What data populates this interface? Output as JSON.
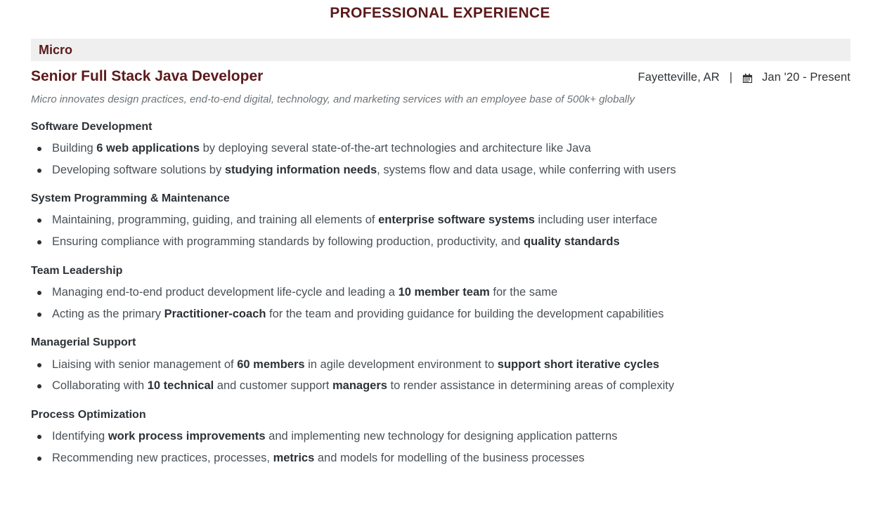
{
  "colors": {
    "accent": "#5c1a1b",
    "band_bg": "#efefef",
    "body_text": "#4a5057",
    "strong_text": "#2d3238",
    "muted_italic": "#6f7479"
  },
  "header": {
    "section_title": "PROFESSIONAL EXPERIENCE"
  },
  "experience": {
    "company": "Micro",
    "job_title": "Senior Full Stack Java Developer",
    "location": "Fayetteville, AR",
    "separator": "|",
    "calendar_icon": "calendar-icon",
    "dates": "Jan '20  -  Present",
    "company_description": "Micro innovates design practices, end-to-end digital, technology, and marketing services with an employee base of 500k+ globally",
    "groups": [
      {
        "heading": "Software Development",
        "bullets": [
          [
            {
              "t": "Building ",
              "b": false
            },
            {
              "t": "6 web applications",
              "b": true
            },
            {
              "t": " by deploying several state-of-the-art technologies and architecture like Java",
              "b": false
            }
          ],
          [
            {
              "t": "Developing software solutions by ",
              "b": false
            },
            {
              "t": "studying information needs",
              "b": true
            },
            {
              "t": ", systems flow and data usage, while conferring with users",
              "b": false
            }
          ]
        ]
      },
      {
        "heading": "System Programming & Maintenance",
        "bullets": [
          [
            {
              "t": "Maintaining, programming, guiding, and training all elements of ",
              "b": false
            },
            {
              "t": "enterprise software systems",
              "b": true
            },
            {
              "t": " including user interface",
              "b": false
            }
          ],
          [
            {
              "t": "Ensuring compliance with programming standards by following production, productivity, and ",
              "b": false
            },
            {
              "t": "quality standards",
              "b": true
            }
          ]
        ]
      },
      {
        "heading": "Team Leadership",
        "bullets": [
          [
            {
              "t": "Managing end-to-end product development life-cycle and leading a ",
              "b": false
            },
            {
              "t": "10 member team",
              "b": true
            },
            {
              "t": " for the same",
              "b": false
            }
          ],
          [
            {
              "t": "Acting as the primary ",
              "b": false
            },
            {
              "t": "Practitioner-coach",
              "b": true
            },
            {
              "t": " for the team and providing guidance for building the development capabilities",
              "b": false
            }
          ]
        ]
      },
      {
        "heading": "Managerial Support",
        "bullets": [
          [
            {
              "t": "Liaising with senior management of ",
              "b": false
            },
            {
              "t": "60 members",
              "b": true
            },
            {
              "t": " in agile development environment to ",
              "b": false
            },
            {
              "t": "support short iterative cycles",
              "b": true
            }
          ],
          [
            {
              "t": "Collaborating with ",
              "b": false
            },
            {
              "t": "10 technical",
              "b": true
            },
            {
              "t": " and customer support ",
              "b": false
            },
            {
              "t": "managers",
              "b": true
            },
            {
              "t": " to render assistance in determining areas of complexity",
              "b": false
            }
          ]
        ]
      },
      {
        "heading": "Process Optimization",
        "bullets": [
          [
            {
              "t": "Identifying ",
              "b": false
            },
            {
              "t": "work process improvements",
              "b": true
            },
            {
              "t": " and implementing new technology for designing application patterns",
              "b": false
            }
          ],
          [
            {
              "t": "Recommending new practices, processes, ",
              "b": false
            },
            {
              "t": "metrics",
              "b": true
            },
            {
              "t": " and models for modelling of the business processes",
              "b": false
            }
          ]
        ]
      }
    ]
  }
}
